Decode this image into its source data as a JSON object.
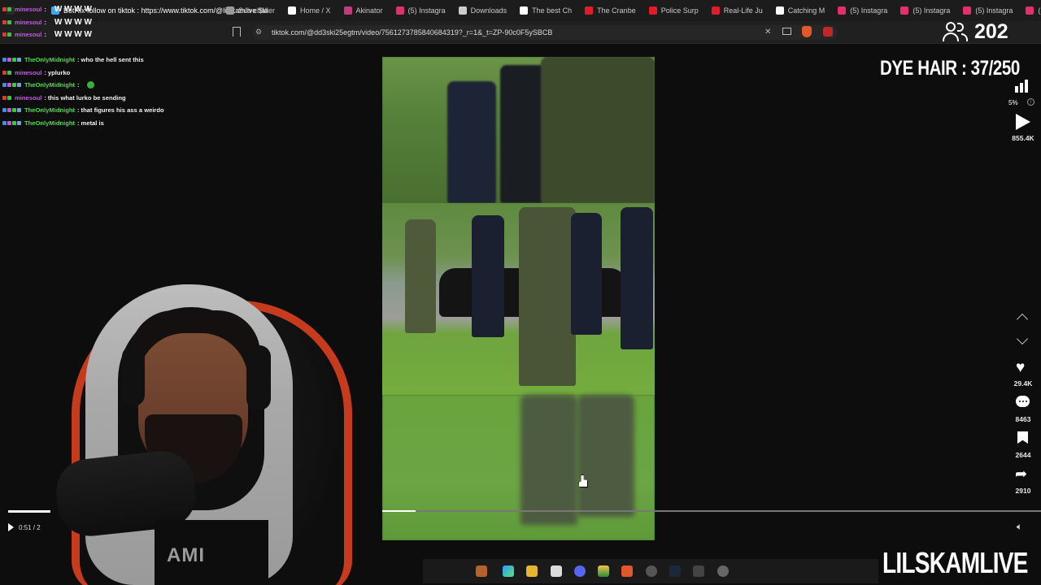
{
  "tabs": [
    {
      "label": "",
      "color": "#2a2a2a"
    },
    {
      "label": "BotRix follow on tiktok : https://www.tiktok.com/@lilskamlive $la",
      "color": "#3aa8ff"
    },
    {
      "label": "Sub challer",
      "color": "#9a9a9a"
    },
    {
      "label": "Home / X",
      "color": "#ffffff"
    },
    {
      "label": "Akinator",
      "color": "#c23b7c"
    },
    {
      "label": "(5) Instagra",
      "color": "#e1306c"
    },
    {
      "label": "Downloads",
      "color": "#cccccc"
    },
    {
      "label": "The best Ch",
      "color": "#ffffff"
    },
    {
      "label": "The Cranbe",
      "color": "#e21b2c"
    },
    {
      "label": "Police Surp",
      "color": "#e21b2c"
    },
    {
      "label": "Real-Life Ju",
      "color": "#e21b2c"
    },
    {
      "label": "Catching M",
      "color": "#ffffff"
    },
    {
      "label": "(5) Instagra",
      "color": "#e1306c"
    },
    {
      "label": "(5) Instagra",
      "color": "#e1306c"
    },
    {
      "label": "(5) Instagra",
      "color": "#e1306c"
    },
    {
      "label": "(5) Inst",
      "color": "#e1306c"
    }
  ],
  "address_bar": {
    "url": "tiktok.com/@dd3ski25egtm/video/7561273785840684319?_r=1&_t=ZP-90c0F5ySBCB"
  },
  "viewers": {
    "count": "202",
    "icon": "people-icon"
  },
  "chat": [
    {
      "user": "minesoul",
      "sep": " :",
      "msg": "",
      "extra": "W W W W",
      "color": "#c45be3",
      "badges": [
        "#e33",
        "#3c3"
      ]
    },
    {
      "user": "minesoul",
      "sep": " :",
      "msg": "",
      "extra": "W W W W",
      "color": "#c45be3",
      "badges": [
        "#e33",
        "#3c3"
      ]
    },
    {
      "user": "minesoul",
      "sep": " :",
      "msg": "",
      "extra": "W W W W",
      "color": "#c45be3",
      "badges": [
        "#e33",
        "#3c3"
      ]
    },
    {
      "user": "",
      "sep": "",
      "msg": "",
      "extra": "",
      "color": "#c45be3",
      "badges": []
    },
    {
      "user": "TheOnlyMidnight",
      "sep": " :",
      "msg": " who the hell sent this",
      "extra": "",
      "color": "#4fd74f",
      "badges": [
        "#3a8cff",
        "#b95bd6",
        "#3c3",
        "#6ad"
      ]
    },
    {
      "user": "minesoul",
      "sep": " :",
      "msg": " yplurko",
      "extra": "",
      "color": "#c45be3",
      "badges": [
        "#e33",
        "#3c3"
      ]
    },
    {
      "user": "TheOnlyMidnight",
      "sep": " :",
      "msg": "",
      "extra": "",
      "color": "#4fd74f",
      "badges": [
        "#3a8cff",
        "#b95bd6",
        "#3c3",
        "#6ad"
      ]
    },
    {
      "user": "minesoul",
      "sep": " :",
      "msg": " this what lurko be sending",
      "extra": "",
      "color": "#c45be3",
      "badges": [
        "#e33",
        "#3c3"
      ]
    },
    {
      "user": "TheOnlyMidnight",
      "sep": " :",
      "msg": " that figures his ass a weirdo",
      "extra": "",
      "color": "#4fd74f",
      "badges": [
        "#3a8cff",
        "#b95bd6",
        "#3c3",
        "#6ad"
      ]
    },
    {
      "user": "TheOnlyMidnight",
      "sep": " :",
      "msg": " metal is",
      "extra": "",
      "color": "#4fd74f",
      "badges": [
        "#3a8cff",
        "#b95bd6",
        "#3c3",
        "#6ad"
      ]
    }
  ],
  "overlay": {
    "dye_hair": "DYE HAIR : 37/250",
    "brand": "LILSKAMLIVE"
  },
  "player": {
    "volume_percent": "5%",
    "progress_fraction": 0.05,
    "plays": "855.4K",
    "likes": "29.4K",
    "comments": "8463",
    "saves": "2644",
    "shares": "2910",
    "time": "0:51 / 2"
  },
  "webcam": {
    "shirt_text": "AMI"
  }
}
